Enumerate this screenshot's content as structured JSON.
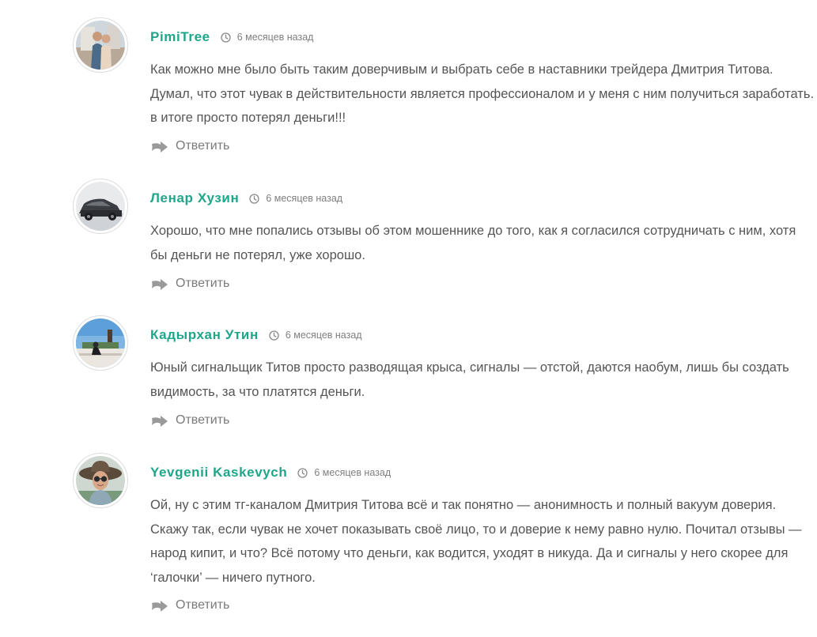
{
  "comments": [
    {
      "author": "PimiTree",
      "time": "6 месяцев назад",
      "text": "Как можно мне было быть таким доверчивым и выбрать себе в наставники трейдера Дмитрия Титова. Думал, что этот чувак в действительности является профессионалом и у меня с ним получиться заработать. в итоге просто потерял деньги!!!",
      "reply_label": "Ответить",
      "avatar_icon": "person-photo-icon"
    },
    {
      "author": "Ленар Хузин",
      "time": "6 месяцев назад",
      "text": "Хорошо, что мне попались отзывы об этом мошеннике до того, как я согласился сотрудничать с ним, хотя бы деньги не потерял, уже хорошо.",
      "reply_label": "Ответить",
      "avatar_icon": "car-photo-icon"
    },
    {
      "author": "Кадырхан Утин",
      "time": "6 месяцев назад",
      "text": "Юный сигнальщик Титов просто разводящая крыса, сигналы — отстой, даются наобум, лишь бы создать видимость, за что платятся деньги.",
      "reply_label": "Ответить",
      "avatar_icon": "landscape-photo-icon"
    },
    {
      "author": "Yevgenii Kaskevych",
      "time": "6 месяцев назад",
      "text": "Ой, ну с этим тг-каналом Дмитрия Титова всё и так понятно — анонимность и полный вакуум доверия. Скажу так, если чувак не хочет показывать своё лицо, то и доверие к нему равно нулю. Почитал отзывы — народ кипит, и что? Всё потому что деньги, как водится, уходят в никуда. Да и сигналы у него скорее для ‘галочки’ — ничего путного.",
      "reply_label": "Ответить",
      "avatar_icon": "hat-portrait-icon"
    }
  ],
  "colors": {
    "author": "#1fa68a",
    "text": "#555555",
    "meta": "#7f7f7f",
    "reply": "#7a7a7a"
  }
}
